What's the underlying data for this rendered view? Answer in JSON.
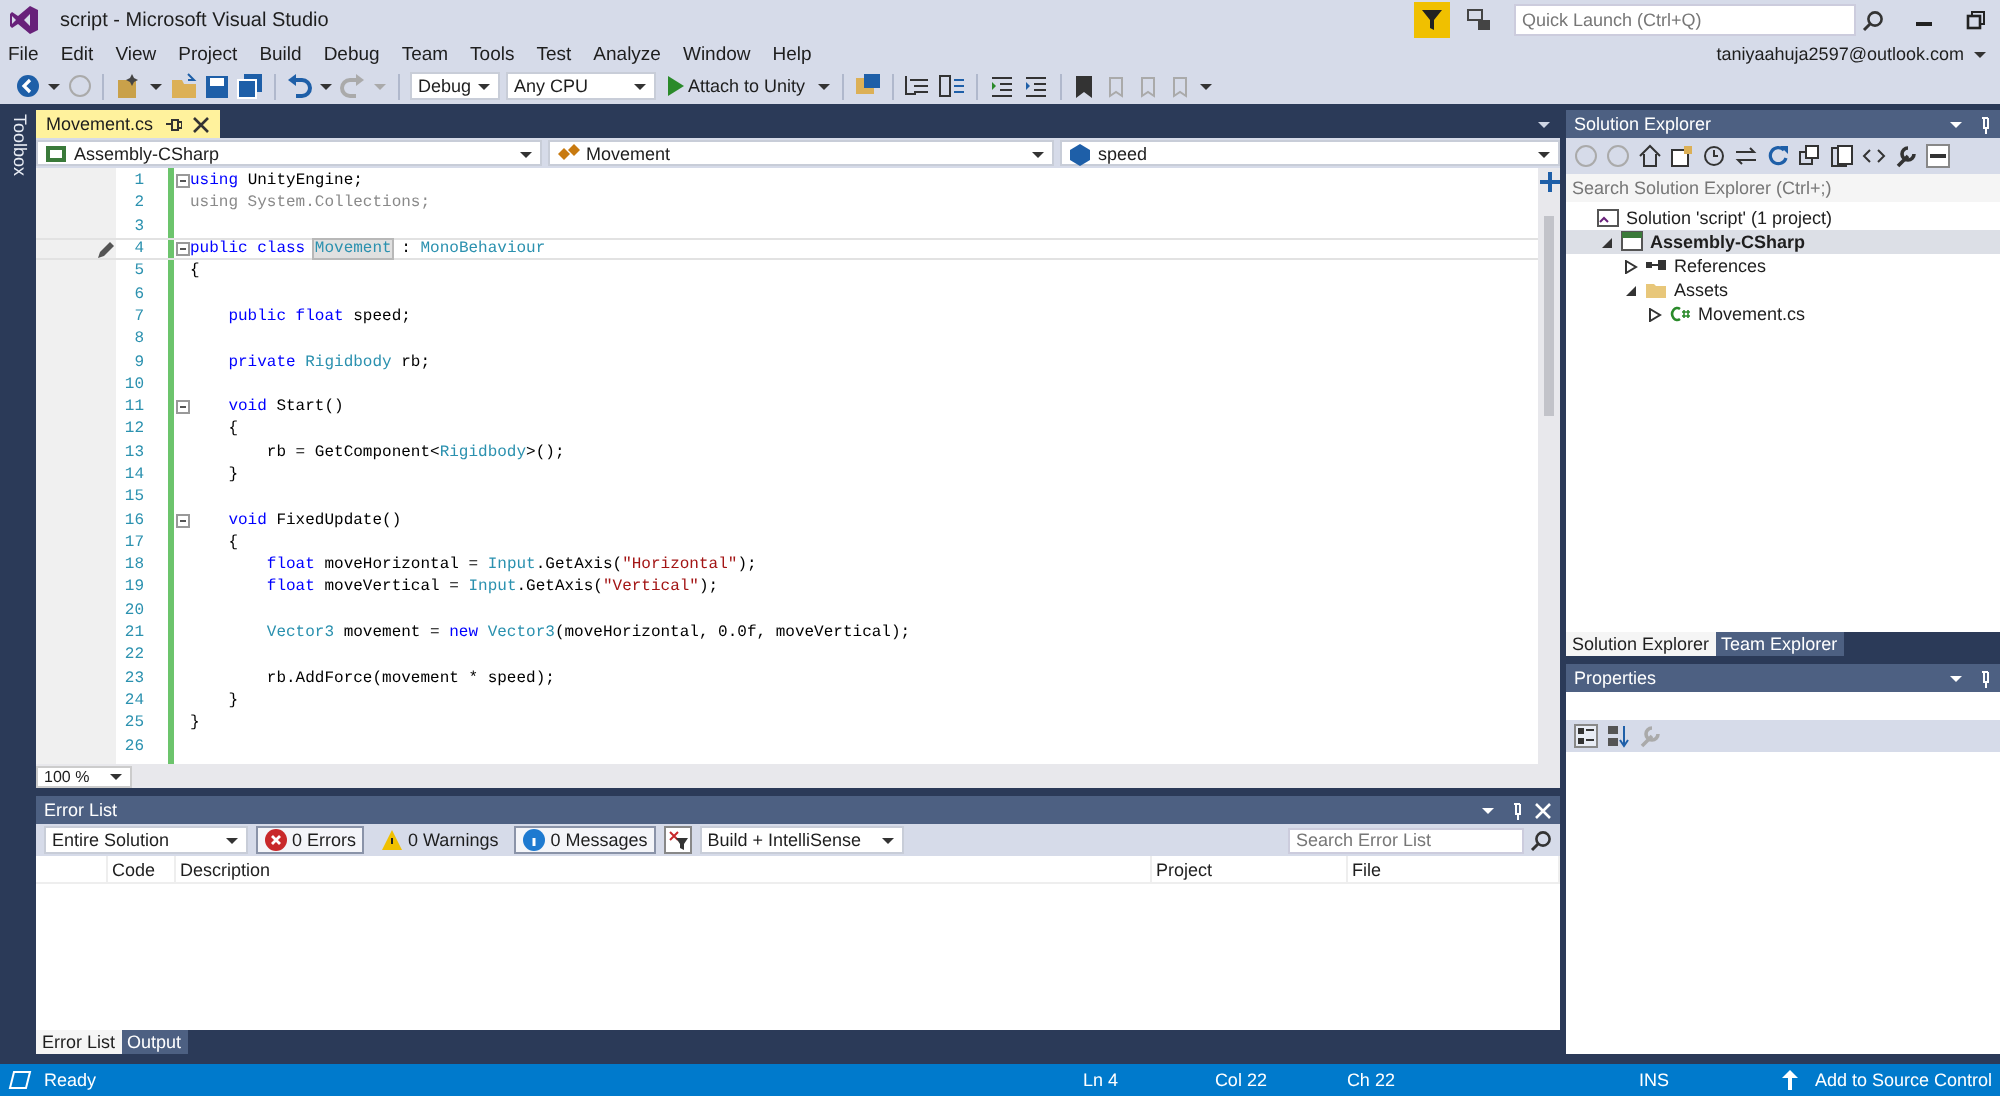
{
  "window": {
    "title": "script - Microsoft Visual Studio"
  },
  "quick_launch": {
    "placeholder": "Quick Launch (Ctrl+Q)"
  },
  "account": "taniyaahuja2597@outlook.com",
  "menu": [
    "File",
    "Edit",
    "View",
    "Project",
    "Build",
    "Debug",
    "Team",
    "Tools",
    "Test",
    "Analyze",
    "Window",
    "Help"
  ],
  "toolbar": {
    "configuration": "Debug",
    "platform": "Any CPU",
    "run_button": "Attach to Unity"
  },
  "side_tab": "Toolbox",
  "editor": {
    "tabs": [
      {
        "label": "Movement.cs",
        "selected": true
      }
    ],
    "nav": [
      "Assembly-CSharp",
      "Movement",
      "speed"
    ],
    "lines": [
      {
        "number": "1",
        "collapsible": true,
        "current": false,
        "tokens": [
          {
            "kind": "kw",
            "text": "using"
          },
          {
            "kind": "plain",
            "text": " UnityEngine;"
          }
        ]
      },
      {
        "number": "2",
        "collapsible": false,
        "current": false,
        "tokens": [
          {
            "kind": "dim",
            "text": "using System.Collections;"
          }
        ]
      },
      {
        "number": "3",
        "collapsible": false,
        "current": false
      },
      {
        "number": "4",
        "collapsible": true,
        "current": true,
        "tokens": [
          {
            "kind": "kw",
            "text": "public class "
          },
          {
            "kind": "highlight",
            "text": "Movement"
          },
          {
            "kind": "plain",
            "text": " : "
          },
          {
            "kind": "type",
            "text": "MonoBehaviour"
          }
        ]
      },
      {
        "number": "5",
        "collapsible": false,
        "current": false,
        "tokens": [
          {
            "kind": "plain",
            "text": "{"
          }
        ]
      },
      {
        "number": "6",
        "collapsible": false,
        "current": false
      },
      {
        "number": "7",
        "collapsible": false,
        "current": false,
        "tokens": [
          {
            "kind": "kw",
            "text": "    public float"
          },
          {
            "kind": "plain",
            "text": " speed;"
          }
        ]
      },
      {
        "number": "8",
        "collapsible": false,
        "current": false
      },
      {
        "number": "9",
        "collapsible": false,
        "current": false,
        "tokens": [
          {
            "kind": "kw",
            "text": "    private "
          },
          {
            "kind": "type",
            "text": "Rigidbody"
          },
          {
            "kind": "plain",
            "text": " rb;"
          }
        ]
      },
      {
        "number": "10",
        "collapsible": false,
        "current": false
      },
      {
        "number": "11",
        "collapsible": true,
        "current": false,
        "tokens": [
          {
            "kind": "kw",
            "text": "    void"
          },
          {
            "kind": "plain",
            "text": " Start()"
          }
        ]
      },
      {
        "number": "12",
        "collapsible": false,
        "current": false,
        "tokens": [
          {
            "kind": "plain",
            "text": "    {"
          }
        ]
      },
      {
        "number": "13",
        "collapsible": false,
        "current": false,
        "tokens": [
          {
            "kind": "plain",
            "text": "        rb = GetComponent<"
          },
          {
            "kind": "type",
            "text": "Rigidbody"
          },
          {
            "kind": "plain",
            "text": ">();"
          }
        ]
      },
      {
        "number": "14",
        "collapsible": false,
        "current": false,
        "tokens": [
          {
            "kind": "plain",
            "text": "    }"
          }
        ]
      },
      {
        "number": "15",
        "collapsible": false,
        "current": false
      },
      {
        "number": "16",
        "collapsible": true,
        "current": false,
        "tokens": [
          {
            "kind": "kw",
            "text": "    void"
          },
          {
            "kind": "plain",
            "text": " FixedUpdate()"
          }
        ]
      },
      {
        "number": "17",
        "collapsible": false,
        "current": false,
        "tokens": [
          {
            "kind": "plain",
            "text": "    {"
          }
        ]
      },
      {
        "number": "18",
        "collapsible": false,
        "current": false,
        "tokens": [
          {
            "kind": "kw",
            "text": "        float"
          },
          {
            "kind": "plain",
            "text": " moveHorizontal = "
          },
          {
            "kind": "type",
            "text": "Input"
          },
          {
            "kind": "plain",
            "text": ".GetAxis("
          },
          {
            "kind": "str",
            "text": "\"Horizontal\""
          },
          {
            "kind": "plain",
            "text": ");"
          }
        ]
      },
      {
        "number": "19",
        "collapsible": false,
        "current": false,
        "tokens": [
          {
            "kind": "kw",
            "text": "        float"
          },
          {
            "kind": "plain",
            "text": " moveVertical = "
          },
          {
            "kind": "type",
            "text": "Input"
          },
          {
            "kind": "plain",
            "text": ".GetAxis("
          },
          {
            "kind": "str",
            "text": "\"Vertical\""
          },
          {
            "kind": "plain",
            "text": ");"
          }
        ]
      },
      {
        "number": "20",
        "collapsible": false,
        "current": false
      },
      {
        "number": "21",
        "collapsible": false,
        "current": false,
        "tokens": [
          {
            "kind": "type",
            "text": "        Vector3"
          },
          {
            "kind": "plain",
            "text": " movement = "
          },
          {
            "kind": "kw",
            "text": "new "
          },
          {
            "kind": "type",
            "text": "Vector3"
          },
          {
            "kind": "plain",
            "text": "(moveHorizontal, 0.0f, moveVertical);"
          }
        ]
      },
      {
        "number": "22",
        "collapsible": false,
        "current": false
      },
      {
        "number": "23",
        "collapsible": false,
        "current": false,
        "tokens": [
          {
            "kind": "plain",
            "text": "        rb.AddForce(movement * speed);"
          }
        ]
      },
      {
        "number": "24",
        "collapsible": false,
        "current": false,
        "tokens": [
          {
            "kind": "plain",
            "text": "    }"
          }
        ]
      },
      {
        "number": "25",
        "collapsible": false,
        "current": false,
        "tokens": [
          {
            "kind": "plain",
            "text": "}"
          }
        ]
      },
      {
        "number": "26",
        "collapsible": false,
        "current": false
      }
    ],
    "zoom": "100 %"
  },
  "error_list": {
    "title": "Error List",
    "scope": "Entire Solution",
    "filters": [
      {
        "kind": "error",
        "label": "0 Errors",
        "selected": true
      },
      {
        "kind": "warning",
        "label": "0 Warnings",
        "selected": false
      },
      {
        "kind": "message",
        "label": "0 Messages",
        "selected": true
      }
    ],
    "source": "Build + IntelliSense",
    "search": {
      "placeholder": "Search Error List"
    },
    "columns": [
      "Code",
      "Description",
      "Project",
      "File"
    ],
    "tabs": [
      {
        "label": "Error List",
        "selected": true
      },
      {
        "label": "Output",
        "selected": false
      }
    ]
  },
  "solution_explorer": {
    "title": "Solution Explorer",
    "search": {
      "placeholder": "Search Solution Explorer (Ctrl+;)"
    },
    "tree": [
      {
        "kind": "solution",
        "label": "Solution 'script' (1 project)",
        "selected": false,
        "children": [
          {
            "kind": "project",
            "label": "Assembly-CSharp",
            "selected": true,
            "expanded": true,
            "children": [
              {
                "kind": "references",
                "label": "References",
                "selected": false,
                "expanded": false
              },
              {
                "kind": "folder",
                "label": "Assets",
                "selected": false,
                "expanded": true,
                "children": [
                  {
                    "kind": "csfile",
                    "label": "Movement.cs",
                    "selected": false,
                    "expanded": false
                  }
                ]
              }
            ]
          }
        ]
      }
    ],
    "tabs": [
      {
        "label": "Solution Explorer",
        "selected": true
      },
      {
        "label": "Team Explorer",
        "selected": false
      }
    ]
  },
  "properties": {
    "title": "Properties"
  },
  "status_bar": {
    "state": "Ready",
    "line": "Ln 4",
    "column": "Col 22",
    "char": "Ch 22",
    "mode": "INS",
    "source_control": "Add to Source Control"
  }
}
